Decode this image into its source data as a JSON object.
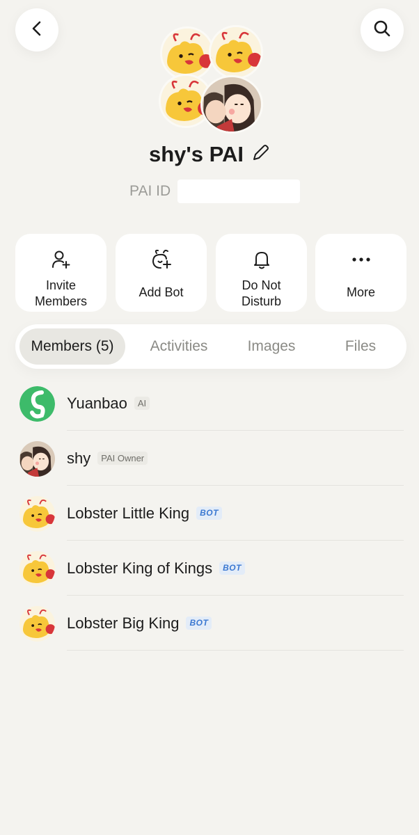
{
  "header": {
    "back_icon": "chevron-left-icon",
    "search_icon": "search-icon"
  },
  "group": {
    "title": "shy's PAI",
    "edit_icon": "pencil-icon",
    "id_label": "PAI ID"
  },
  "actions": [
    {
      "label": "Invite Members",
      "icon": "add-user-icon"
    },
    {
      "label": "Add Bot",
      "icon": "add-bot-icon"
    },
    {
      "label": "Do Not Disturb",
      "icon": "bell-icon"
    },
    {
      "label": "More",
      "icon": "more-dots-icon"
    }
  ],
  "tabs": [
    {
      "label": "Members (5)",
      "active": true
    },
    {
      "label": "Activities",
      "active": false
    },
    {
      "label": "Images",
      "active": false
    },
    {
      "label": "Files",
      "active": false
    }
  ],
  "members": [
    {
      "name": "Yuanbao",
      "badge": "AI",
      "badge_type": "ai",
      "avatar": "yuanbao-logo"
    },
    {
      "name": "shy",
      "badge": "PAI Owner",
      "badge_type": "owner",
      "avatar": "couple-illustration"
    },
    {
      "name": "Lobster Little King",
      "badge": "BOT",
      "badge_type": "bot",
      "avatar": "lobster-mascot"
    },
    {
      "name": "Lobster King of Kings",
      "badge": "BOT",
      "badge_type": "bot",
      "avatar": "lobster-mascot"
    },
    {
      "name": "Lobster Big King",
      "badge": "BOT",
      "badge_type": "bot",
      "avatar": "lobster-mascot"
    }
  ],
  "colors": {
    "background": "#f4f3ef",
    "card": "#ffffff",
    "active_tab": "#e8e7e2",
    "bot_badge": "#3b78d1",
    "yuanbao_green": "#3dbb6a",
    "lobster_yellow": "#f7c73a",
    "lobster_red": "#d8363a"
  }
}
